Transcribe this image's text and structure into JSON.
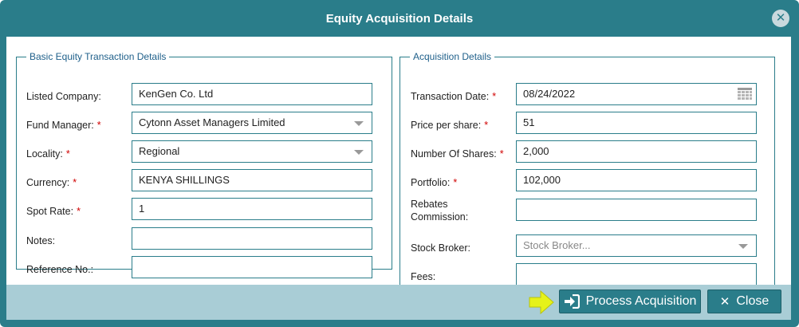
{
  "dialog": {
    "title": "Equity Acquisition Details",
    "close_glyph": "✕"
  },
  "left": {
    "legend": "Basic Equity Transaction Details",
    "fields": [
      {
        "label": "Listed Company:",
        "required": false,
        "value": "KenGen Co. Ltd",
        "type": "text"
      },
      {
        "label": "Fund Manager:",
        "required": true,
        "value": "Cytonn Asset Managers Limited",
        "type": "select"
      },
      {
        "label": "Locality:",
        "required": true,
        "value": "Regional",
        "type": "select"
      },
      {
        "label": "Currency:",
        "required": true,
        "value": "KENYA SHILLINGS",
        "type": "text"
      },
      {
        "label": "Spot Rate:",
        "required": true,
        "value": "1",
        "type": "text"
      },
      {
        "label": "Notes:",
        "required": false,
        "value": "",
        "type": "text"
      },
      {
        "label": "Reference No.:",
        "required": false,
        "value": "",
        "type": "text"
      }
    ]
  },
  "right": {
    "legend": "Acquisition Details",
    "fields": [
      {
        "label": "Transaction Date:",
        "required": true,
        "value": "08/24/2022",
        "type": "date"
      },
      {
        "label": "Price per share:",
        "required": true,
        "value": "51",
        "type": "text"
      },
      {
        "label": "Number Of Shares:",
        "required": true,
        "value": "2,000",
        "type": "text"
      },
      {
        "label": "Portfolio:",
        "required": true,
        "value": "102,000",
        "type": "text"
      },
      {
        "label_line1": "Rebates",
        "label_line2": "Commission:",
        "required": false,
        "value": "",
        "type": "text"
      },
      {
        "label": "Stock Broker:",
        "required": false,
        "value": "",
        "placeholder": "Stock Broker...",
        "type": "select"
      },
      {
        "label": "Fees:",
        "required": false,
        "value": "",
        "type": "text"
      }
    ]
  },
  "required_marker": "*",
  "footer": {
    "process_label": "Process Acquisition",
    "close_label": "Close",
    "close_glyph": "✕"
  },
  "colors": {
    "header": "#2a7d8a",
    "footer": "#a9cdd6",
    "required": "#d00000",
    "pointer": "#e6f21a"
  }
}
